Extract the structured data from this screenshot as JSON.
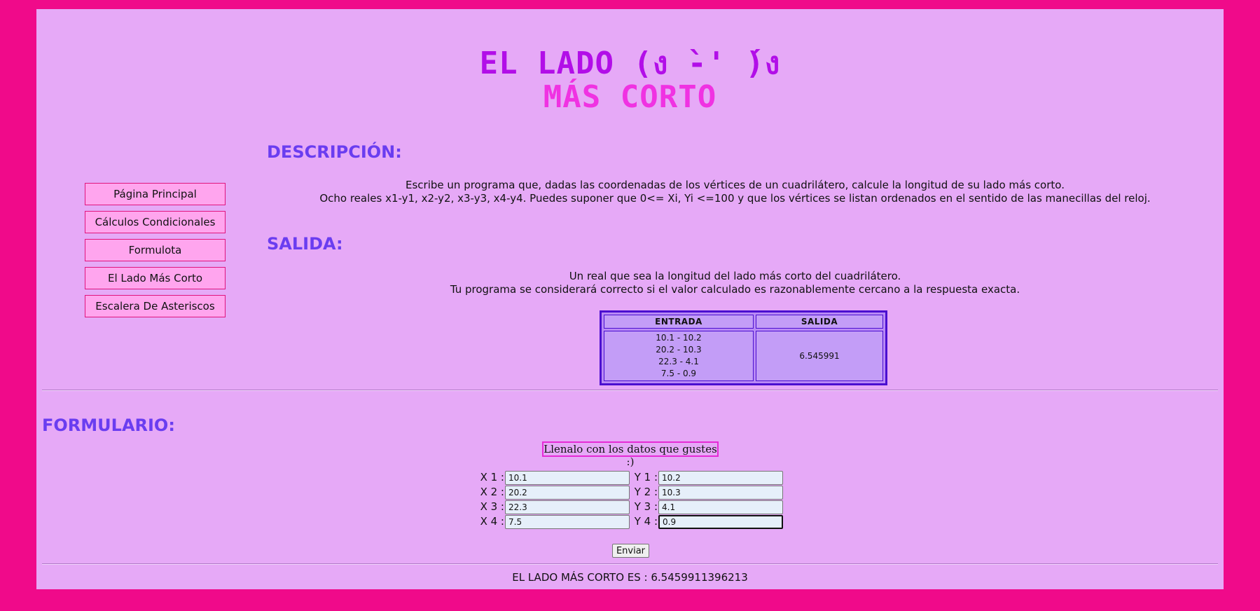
{
  "header": {
    "title_line1": "EL LADO (ง ̀-' ́)ง",
    "title_line2": "MÁS CORTO"
  },
  "nav": {
    "items": [
      {
        "label": "Página Principal"
      },
      {
        "label": "Cálculos Condicionales"
      },
      {
        "label": "Formulota"
      },
      {
        "label": "El Lado Más Corto"
      },
      {
        "label": "Escalera De Asteriscos"
      }
    ]
  },
  "description": {
    "heading": "DESCRIPCIÓN:",
    "line1": "Escribe un programa que, dadas las coordenadas de los vértices de un cuadrilátero, calcule la longitud de su lado más corto.",
    "line2": "Ocho reales x1-y1, x2-y2, x3-y3, x4-y4. Puedes suponer que 0<= Xi, Yi <=100 y que los vértices se listan ordenados en el sentido de las manecillas del reloj."
  },
  "output_section": {
    "heading": "SALIDA:",
    "line1": "Un real que sea la longitud del lado más corto del cuadrilátero.",
    "line2": "Tu programa se considerará correcto si el valor calculado es razonablemente cercano a la respuesta exacta."
  },
  "example_table": {
    "headers": [
      "ENTRADA",
      "SALIDA"
    ],
    "input_lines": [
      "10.1 - 10.2",
      "20.2 - 10.3",
      "22.3 - 4.1",
      "7.5 - 0.9"
    ],
    "output": "6.545991"
  },
  "form": {
    "heading": "FORMULARIO:",
    "legend": "Llenalo con los datos que gustes :)",
    "fields": [
      {
        "x_label": "X 1 :",
        "x_value": "10.1",
        "y_label": "Y 1 :",
        "y_value": "10.2"
      },
      {
        "x_label": "X 2 :",
        "x_value": "20.2",
        "y_label": "Y 2 :",
        "y_value": "10.3"
      },
      {
        "x_label": "X 3 :",
        "x_value": "22.3",
        "y_label": "Y 3 :",
        "y_value": "4.1"
      },
      {
        "x_label": "X 4 :",
        "x_value": "7.5",
        "y_label": "Y 4 :",
        "y_value": "0.9"
      }
    ],
    "submit_label": "Enviar"
  },
  "result": {
    "text": "EL LADO MÁS CORTO ES : 6.5459911396213"
  },
  "colors": {
    "page_border": "#f00a8a",
    "panel_bg": "#e6a9f7",
    "heading": "#6a3df0",
    "title1": "#b20ee8",
    "title2": "#f032e2"
  }
}
